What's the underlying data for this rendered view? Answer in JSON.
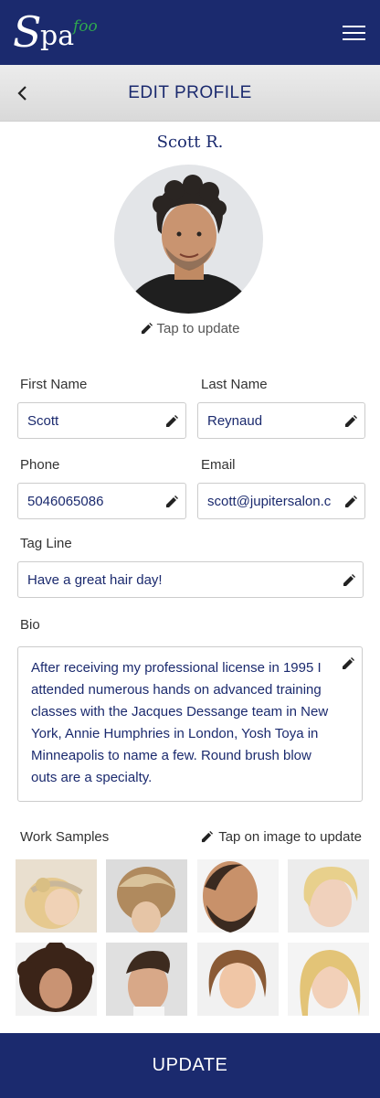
{
  "app": {
    "logo_main": "Spa",
    "logo_suffix": "foo"
  },
  "header": {
    "title": "EDIT PROFILE"
  },
  "profile": {
    "name": "Scott R.",
    "tap_to_update": "Tap to update"
  },
  "form": {
    "first_name": {
      "label": "First Name",
      "value": "Scott"
    },
    "last_name": {
      "label": "Last Name",
      "value": "Reynaud"
    },
    "phone": {
      "label": "Phone",
      "value": "5046065086"
    },
    "email": {
      "label": "Email",
      "value": "scott@jupitersalon.c"
    },
    "tag_line": {
      "label": "Tag Line",
      "value": "Have a great hair day!"
    },
    "bio": {
      "label": "Bio",
      "value": "After receiving my professional license in 1995 I attended numerous hands on advanced training classes with the Jacques Dessange  team in New York, Annie Humphries in London, Yosh Toya in Minneapolis to name a few. Round brush blow outs are a specialty."
    }
  },
  "work_samples": {
    "label": "Work Samples",
    "hint": "Tap on image to update",
    "count": 8
  },
  "footer": {
    "update_label": "UPDATE"
  },
  "colors": {
    "brand_navy": "#1b2a6e",
    "logo_green": "#2fa84f"
  },
  "icons": [
    "menu-icon",
    "back-chevron-icon",
    "pencil-icon"
  ]
}
